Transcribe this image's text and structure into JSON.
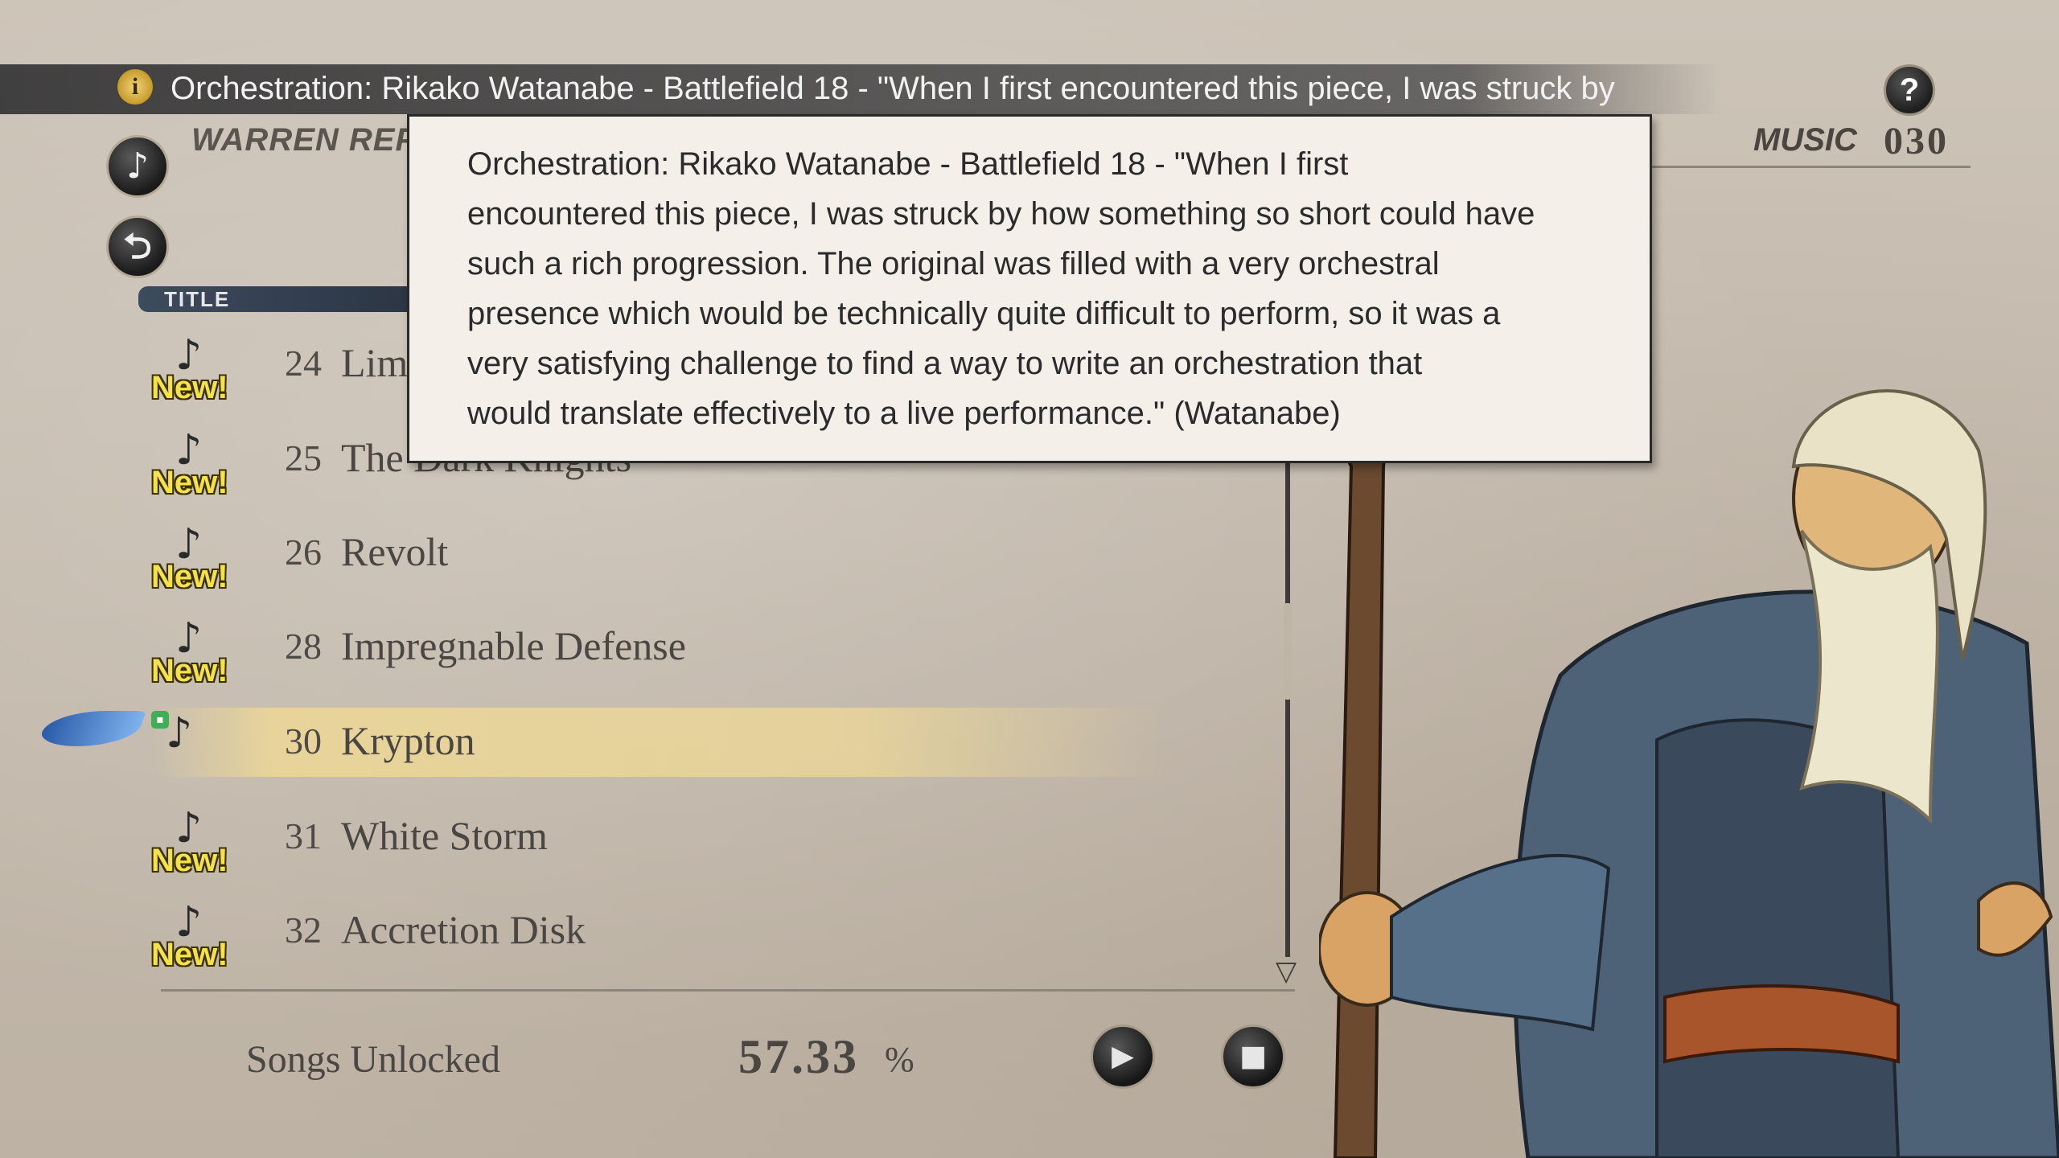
{
  "ticker": {
    "text": "Orchestration: Rikako Watanabe  - Battlefield 18 -  \"When I first encountered this piece, I was struck by"
  },
  "header": {
    "report_label": "WARREN REPO",
    "music_label": "MUSIC",
    "music_count": "030",
    "help_icon": "?"
  },
  "list": {
    "column_title": "TITLE",
    "new_badge": "New!",
    "tracks": [
      {
        "num": "24",
        "title": "Lim"
      },
      {
        "num": "25",
        "title": "The Dark Knights"
      },
      {
        "num": "26",
        "title": "Revolt"
      },
      {
        "num": "28",
        "title": "Impregnable Defense"
      },
      {
        "num": "30",
        "title": "Krypton"
      },
      {
        "num": "31",
        "title": "White Storm"
      },
      {
        "num": "32",
        "title": "Accretion Disk"
      }
    ]
  },
  "footer": {
    "songs_label": "Songs Unlocked",
    "songs_value": "57.33",
    "songs_pct": "%"
  },
  "tooltip": {
    "lines": [
      "Orchestration: Rikako Watanabe  - Battlefield 18 -  \"When I first",
      "encountered this piece, I was struck by how something so short could have",
      "such a rich progression. The original was filled with a very orchestral",
      "presence which would be technically quite difficult to perform, so it was a",
      "very satisfying challenge to find a way to write an orchestration that",
      "would translate effectively to a live performance.\" (Watanabe)"
    ]
  },
  "icons": {
    "ticker": "info-icon",
    "help": "question-icon",
    "music": "music-note-icon",
    "back": "back-icon",
    "play": "play-icon",
    "stop": "stop-icon",
    "cursor": "wing-cursor-icon",
    "lock": "lock-icon"
  }
}
